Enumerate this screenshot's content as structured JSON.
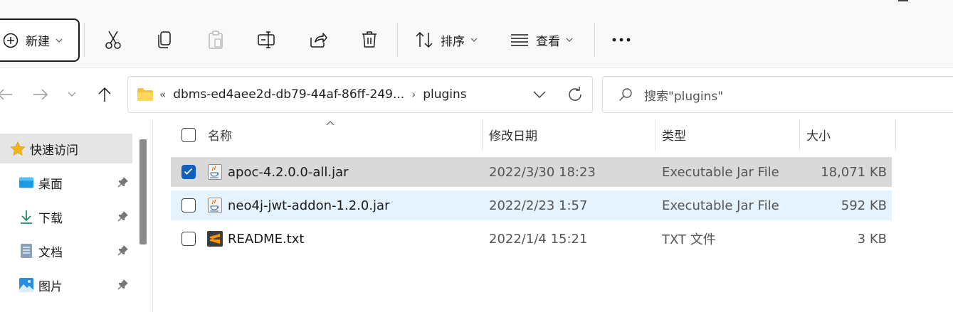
{
  "toolbar": {
    "new_label": "新建",
    "sort_label": "排序",
    "view_label": "查看",
    "more_label": "···"
  },
  "address": {
    "path_truncated": "dbms-ed4aee2d-db79-44af-86ff-249...",
    "leaf": "plugins",
    "overflow_marker": "«",
    "separator": "›"
  },
  "search": {
    "placeholder": "搜索\"plugins\""
  },
  "sidebar": {
    "items": [
      {
        "label": "快速访问",
        "icon": "star-icon",
        "active": true
      },
      {
        "label": "桌面",
        "icon": "desktop-icon",
        "pinned": true
      },
      {
        "label": "下载",
        "icon": "download-icon",
        "pinned": true
      },
      {
        "label": "文档",
        "icon": "document-icon",
        "pinned": true
      },
      {
        "label": "图片",
        "icon": "pictures-icon",
        "pinned": true
      }
    ]
  },
  "columns": {
    "name": "名称",
    "modified": "修改日期",
    "type": "类型",
    "size": "大小"
  },
  "files": [
    {
      "name": "apoc-4.2.0.0-all.jar",
      "modified": "2022/3/30 18:23",
      "type": "Executable Jar File",
      "size": "18,071 KB",
      "selected": true,
      "icon": "java-jar-icon"
    },
    {
      "name": "neo4j-jwt-addon-1.2.0.jar",
      "modified": "2022/2/23 1:57",
      "type": "Executable Jar File",
      "size": "592 KB",
      "selected": false,
      "icon": "java-jar-icon"
    },
    {
      "name": "README.txt",
      "modified": "2022/1/4 15:21",
      "type": "TXT 文件",
      "size": "3 KB",
      "selected": false,
      "icon": "sublime-text-icon"
    }
  ],
  "colors": {
    "accent": "#0f5fbf",
    "selected_row": "#d9d9d9",
    "hover_row": "#e5f3ff",
    "sidebar_active": "#e5e5e5"
  }
}
